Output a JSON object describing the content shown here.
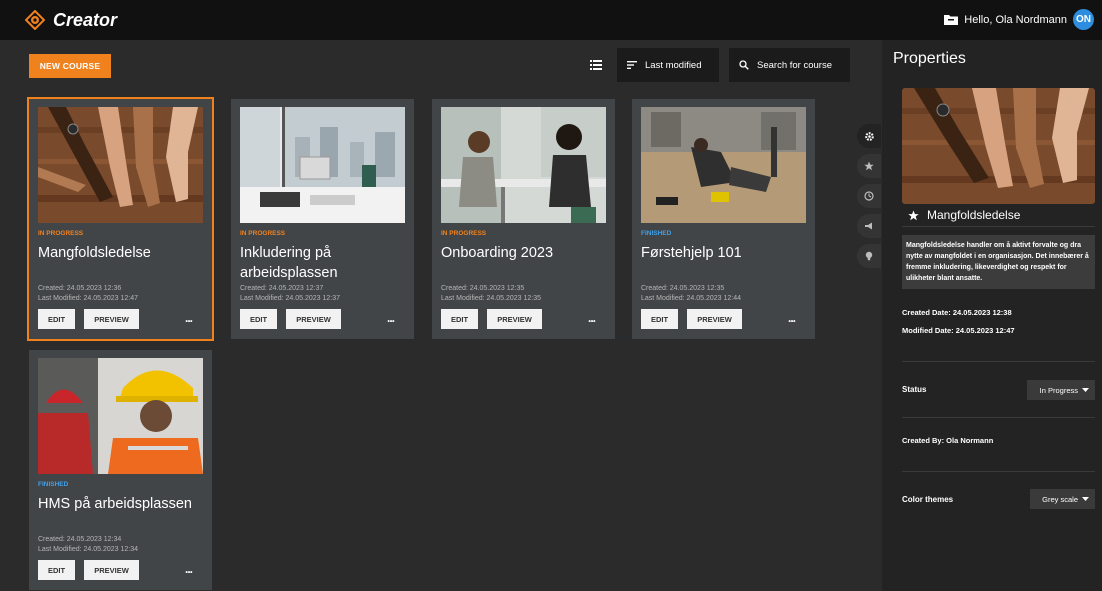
{
  "app": {
    "name": "Creator",
    "greeting": "Hello, Ola Nordmann",
    "avatar_initials": "ON"
  },
  "toolbar": {
    "new_course": "NEW COURSE",
    "sort_label": "Last modified",
    "search_placeholder": "Search for course"
  },
  "courses": [
    {
      "status": "IN PROGRESS",
      "status_color": "#f0821e",
      "title": "Mangfoldsledelse",
      "created": "Created: 24.05.2023 12:36",
      "modified": "Last Modified: 24.05.2023 12:47",
      "edit": "EDIT",
      "preview": "PREVIEW",
      "more": "...",
      "selected": true
    },
    {
      "status": "IN PROGRESS",
      "status_color": "#f0821e",
      "title": "Inkludering på arbeidsplassen",
      "created": "Created: 24.05.2023 12:37",
      "modified": "Last Modified: 24.05.2023 12:37",
      "edit": "EDIT",
      "preview": "PREVIEW",
      "more": "..."
    },
    {
      "status": "IN PROGRESS",
      "status_color": "#f0821e",
      "title": "Onboarding 2023",
      "created": "Created: 24.05.2023 12:35",
      "modified": "Last Modified: 24.05.2023 12:35",
      "edit": "EDIT",
      "preview": "PREVIEW",
      "more": "..."
    },
    {
      "status": "FINISHED",
      "status_color": "#3fa0e8",
      "title": "Førstehjelp 101",
      "created": "Created: 24.05.2023 12:35",
      "modified": "Last Modified: 24.05.2023 12:44",
      "edit": "EDIT",
      "preview": "PREVIEW",
      "more": "..."
    },
    {
      "status": "FINISHED",
      "status_color": "#3fa0e8",
      "title": "HMS på arbeidsplassen",
      "created": "Created: 24.05.2023 12:34",
      "modified": "Last Modified: 24.05.2023 12:34",
      "edit": "EDIT",
      "preview": "PREVIEW",
      "more": "..."
    }
  ],
  "properties": {
    "heading": "Properties",
    "course_title": "Mangfoldsledelse",
    "description": "Mangfoldsledelse handler om å aktivt forvalte og dra nytte av mangfoldet i en organisasjon. Det innebærer å fremme inkludering, likeverdighet og respekt for ulikheter blant ansatte.",
    "created_date": "Created Date: 24.05.2023 12:38",
    "modified_date": "Modified Date: 24.05.2023 12:47",
    "status_label": "Status",
    "status_value": "In Progress",
    "created_by": "Created By: Ola Normann",
    "color_themes_label": "Color themes",
    "color_themes_value": "Grey scale"
  },
  "colors": {
    "accent": "#f0821e",
    "finished": "#3fa0e8",
    "card": "#424548"
  }
}
